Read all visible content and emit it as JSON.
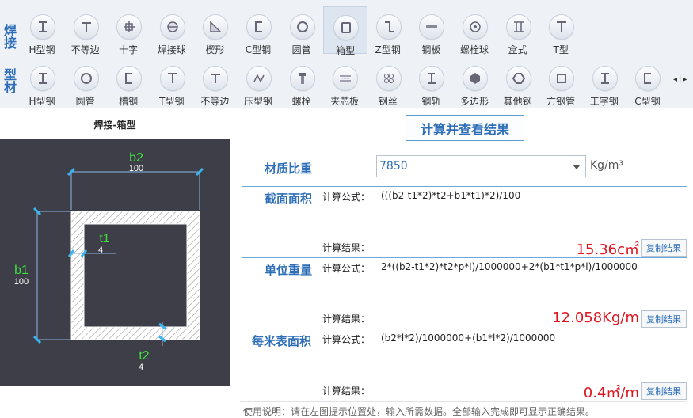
{
  "toolbar": {
    "group1_label": "焊接",
    "group2_label": "型材",
    "row1": [
      {
        "label": "H型钢",
        "icon": "h-beam-icon"
      },
      {
        "label": "不等边",
        "icon": "unequal-angle-icon"
      },
      {
        "label": "十字",
        "icon": "cross-icon"
      },
      {
        "label": "焊接球",
        "icon": "welded-ball-icon"
      },
      {
        "label": "楔形",
        "icon": "wedge-icon"
      },
      {
        "label": "C型钢",
        "icon": "c-channel-icon"
      },
      {
        "label": "圆管",
        "icon": "round-tube-icon"
      },
      {
        "label": "箱型",
        "icon": "box-section-icon"
      },
      {
        "label": "Z型钢",
        "icon": "z-section-icon"
      },
      {
        "label": "钢板",
        "icon": "steel-plate-icon"
      },
      {
        "label": "螺栓球",
        "icon": "bolt-ball-icon"
      },
      {
        "label": "盒式",
        "icon": "box-type-icon"
      },
      {
        "label": "T型",
        "icon": "t-section-icon"
      }
    ],
    "row2": [
      {
        "label": "H型钢",
        "icon": "h-beam-icon"
      },
      {
        "label": "圆管",
        "icon": "round-tube-icon"
      },
      {
        "label": "槽钢",
        "icon": "channel-icon"
      },
      {
        "label": "T型钢",
        "icon": "t-section-icon"
      },
      {
        "label": "不等边",
        "icon": "unequal-angle-icon"
      },
      {
        "label": "压型钢",
        "icon": "profiled-steel-icon"
      },
      {
        "label": "螺栓",
        "icon": "bolt-icon"
      },
      {
        "label": "夹芯板",
        "icon": "sandwich-panel-icon"
      },
      {
        "label": "钢丝",
        "icon": "steel-wire-icon"
      },
      {
        "label": "钢轨",
        "icon": "rail-icon"
      },
      {
        "label": "多边形",
        "icon": "polygon-icon"
      },
      {
        "label": "其他钢",
        "icon": "other-steel-icon"
      },
      {
        "label": "方钢管",
        "icon": "square-tube-icon"
      },
      {
        "label": "工字钢",
        "icon": "i-beam-icon"
      },
      {
        "label": "C型钢",
        "icon": "c-channel-icon"
      }
    ],
    "selected": "箱型"
  },
  "diagram": {
    "title": "焊接-箱型",
    "b2_label": "b2",
    "b2_value": "100",
    "b1_label": "b1",
    "b1_value": "100",
    "t1_label": "t1",
    "t1_value": "4",
    "t2_label": "t2",
    "t2_value": "4"
  },
  "panel": {
    "calc_button": "计算并查看结果",
    "density_label": "材质比重",
    "density_value": "7850",
    "density_unit": "Kg/m³",
    "formula_prefix": "计算公式：",
    "result_prefix": "计算结果：",
    "copy_label": "复制结果",
    "sections": [
      {
        "label": "截面面积",
        "formula": "(((b2-t1*2)*t2+b1*t1)*2)/100",
        "result": "15.36c㎡"
      },
      {
        "label": "单位重量",
        "formula": "2*((b2-t1*2)*t2*p*l)/1000000+2*(b1*t1*p*l)/1000000",
        "result": "12.058Kg/m"
      },
      {
        "label": "每米表面积",
        "formula": "(b2*l*2)/1000000+(b1*l*2)/1000000",
        "result": "0.4㎡/m"
      }
    ],
    "usage": "使用说明：请在左图提示位置处，输入所需数据。全部输入完成即可显示正确结果。"
  }
}
